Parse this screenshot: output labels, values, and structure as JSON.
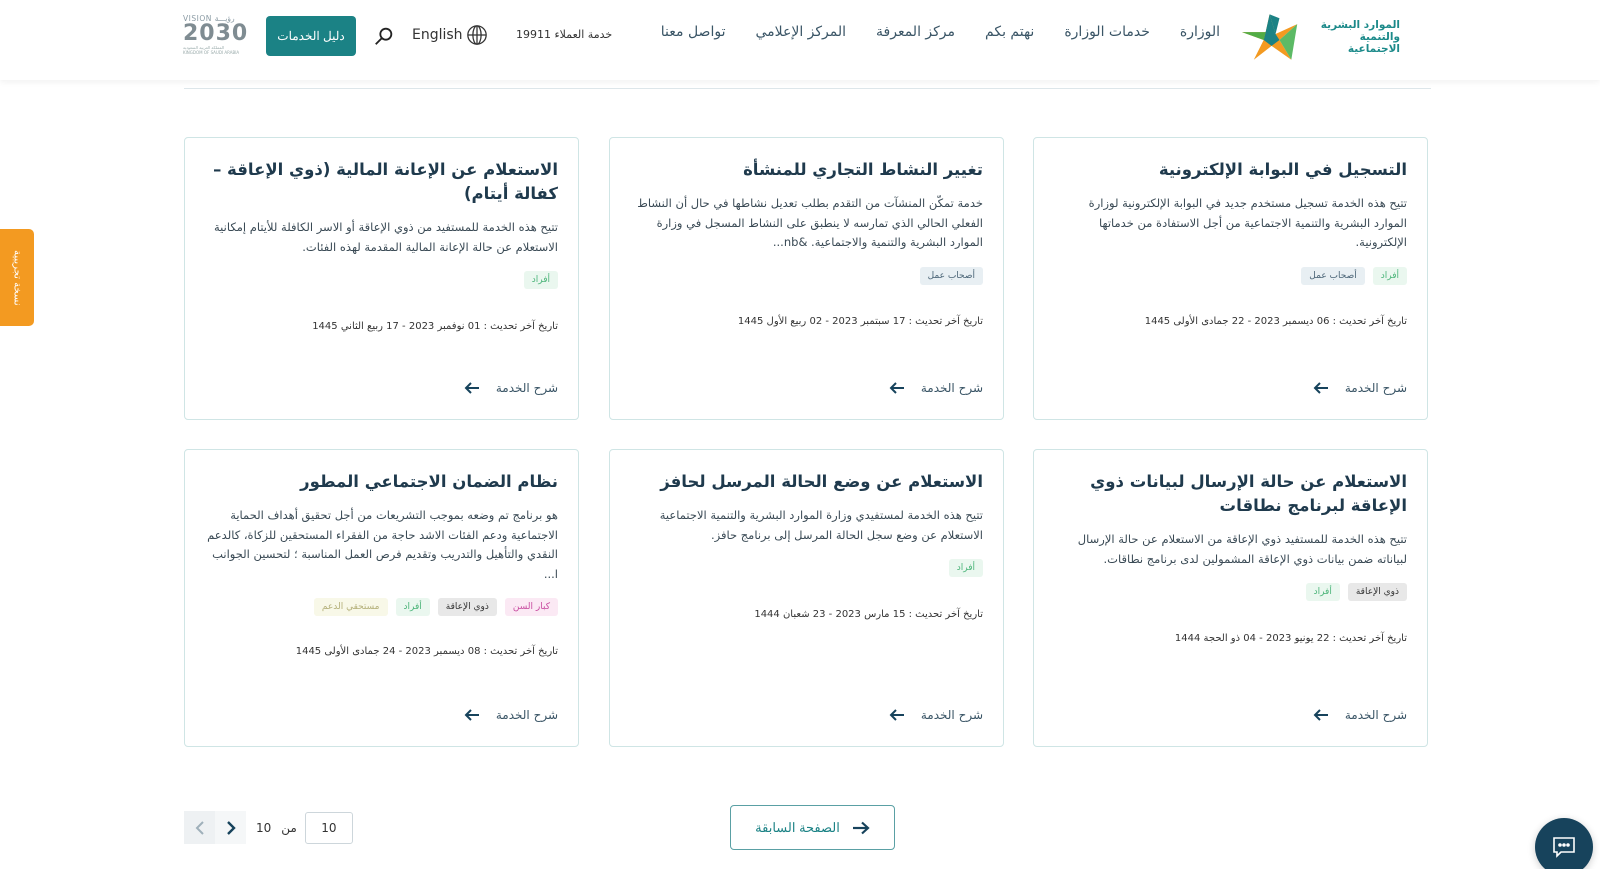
{
  "header": {
    "logo": {
      "line1": "الموارد البشرية",
      "line2": "والتنمية الاجتماعية"
    },
    "nav": [
      {
        "label": "الوزارة"
      },
      {
        "label": "خدمات الوزارة"
      },
      {
        "label": "نهتم بكم"
      },
      {
        "label": "مركز المعرفة"
      },
      {
        "label": "المركز الإعلامي"
      },
      {
        "label": "تواصل معنا"
      }
    ],
    "customer_service": "خدمة العملاء 19911",
    "language_label": "English",
    "services_guide_label": "دليل الخدمات",
    "vision": {
      "top": "VISION رؤيـــة",
      "mid": "2030",
      "bottom1": "المملكة العربية السعودية",
      "bottom2": "KINGDOM OF SAUDI ARABIA"
    }
  },
  "cards": [
    {
      "title": "التسجيل في البوابة الإلكترونية",
      "description": "تتيح هذه الخدمة تسجيل مستخدم جديد في البوابة الإلكترونية لوزارة الموارد البشرية والتنمية الاجتماعية من أجل الاستفادة من خدماتها الإلكترونية.",
      "tags": [
        {
          "label": "أفراد",
          "color": "green"
        },
        {
          "label": "أصحاب عمل",
          "color": "blue"
        }
      ],
      "last_updated": "تاريخ آخر تحديث : 06 ديسمبر 2023 - 22 جمادى الأولى 1445",
      "link_label": "شرح الخدمة"
    },
    {
      "title": "تغيير النشاط التجاري للمنشأة",
      "description": "خدمة تمكّن المنشآت من التقدم بطلب تعديل نشاطها في حال أن النشاط الفعلي الحالي الذي تمارسه لا ينطبق على النشاط المسجل في وزارة الموارد البشرية والتنمية والاجتماعية. &nb...",
      "tags": [
        {
          "label": "أصحاب عمل",
          "color": "blue"
        }
      ],
      "last_updated": "تاريخ آخر تحديث : 17 سبتمبر 2023 - 02 ربيع الأول 1445",
      "link_label": "شرح الخدمة"
    },
    {
      "title": "الاستعلام عن الإعانة المالية (ذوي الإعاقة – كفالة أيتام)",
      "description": "تتيح هذه الخدمة للمستفيد من ذوي الإعاقة أو الاسر الكافلة للأيتام إمكانية الاستعلام عن حالة الإعانة المالية المقدمة لهذه الفئات.",
      "tags": [
        {
          "label": "أفراد",
          "color": "green"
        }
      ],
      "last_updated": "تاريخ آخر تحديث : 01 نوفمبر 2023 - 17 ربيع الثاني 1445",
      "link_label": "شرح الخدمة"
    },
    {
      "title": "الاستعلام عن حالة الإرسال لبيانات ذوي الإعاقة لبرنامج نطاقات",
      "description": "تتيح هذه الخدمة للمستفيد ذوي الإعاقة من الاستعلام عن حالة الإرسال لبياناته ضمن بيانات ذوي الإعاقة المشمولين لدى برنامج نطاقات.",
      "tags": [
        {
          "label": "ذوي الإعاقة",
          "color": "gray"
        },
        {
          "label": "أفراد",
          "color": "green"
        }
      ],
      "last_updated": "تاريخ آخر تحديث : 22 يونيو 2023 - 04 ذو الحجة 1444",
      "link_label": "شرح الخدمة"
    },
    {
      "title": "الاستعلام عن وضع الحالة المرسل لحافز",
      "description": "تتيح هذه الخدمة لمستفيدي وزارة الموارد البشرية والتنمية الاجتماعية الاستعلام عن وضع سجل الحالة المرسل إلى برنامج حافز.",
      "tags": [
        {
          "label": "أفراد",
          "color": "green"
        }
      ],
      "last_updated": "تاريخ آخر تحديث : 15 مارس 2023 - 23 شعبان 1444",
      "link_label": "شرح الخدمة"
    },
    {
      "title": "نظام الضمان الاجتماعي المطور",
      "description": "هو برنامج تم وضعه بموجب التشريعات من أجل تحقيق أهداف الحماية الاجتماعية ودعم الفئات الاشد حاجة من الفقراء المستحقين للزكاة، كالدعم النقدي والتأهيل والتدريب وتقديم فرص العمل المناسبة ؛ لتحسين الجوانب ا...",
      "tags": [
        {
          "label": "كبار السن",
          "color": "pink"
        },
        {
          "label": "ذوي الإعاقة",
          "color": "gray"
        },
        {
          "label": "أفراد",
          "color": "green"
        },
        {
          "label": "مستحقي الدعم",
          "color": "yellow"
        }
      ],
      "last_updated": "تاريخ آخر تحديث : 08 ديسمبر 2023 - 24 جمادى الأولى 1445",
      "link_label": "شرح الخدمة"
    }
  ],
  "pagination": {
    "previous_page_label": "الصفحة السابقة",
    "current_page": "10",
    "of_label": "من",
    "total_pages": "10"
  },
  "beta_tab_label": "نسخة تجريبية",
  "colors": {
    "primary": "#1b8285",
    "navy": "#17435c",
    "beta_orange": "#f39a21",
    "card_border": "#cfe5e5"
  }
}
